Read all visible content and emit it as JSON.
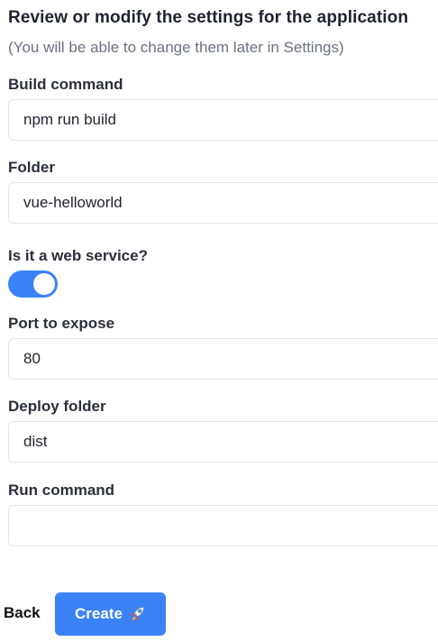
{
  "header": {
    "title": "Review or modify the settings for the application",
    "subtitle": "(You will be able to change them later in Settings)"
  },
  "form": {
    "build_command": {
      "label": "Build command",
      "value": "npm run build"
    },
    "folder": {
      "label": "Folder",
      "value": "vue-helloworld"
    },
    "web_service": {
      "label": "Is it a web service?",
      "enabled": true
    },
    "port": {
      "label": "Port to expose",
      "value": "80"
    },
    "deploy_folder": {
      "label": "Deploy folder",
      "value": "dist"
    },
    "run_command": {
      "label": "Run command",
      "value": ""
    }
  },
  "actions": {
    "back_label": "Back",
    "create_label": "Create",
    "create_icon": "rocket-icon"
  },
  "colors": {
    "accent": "#3b82f6",
    "text": "#1f2330",
    "muted": "#6b7280",
    "border": "#e3e5ea"
  }
}
